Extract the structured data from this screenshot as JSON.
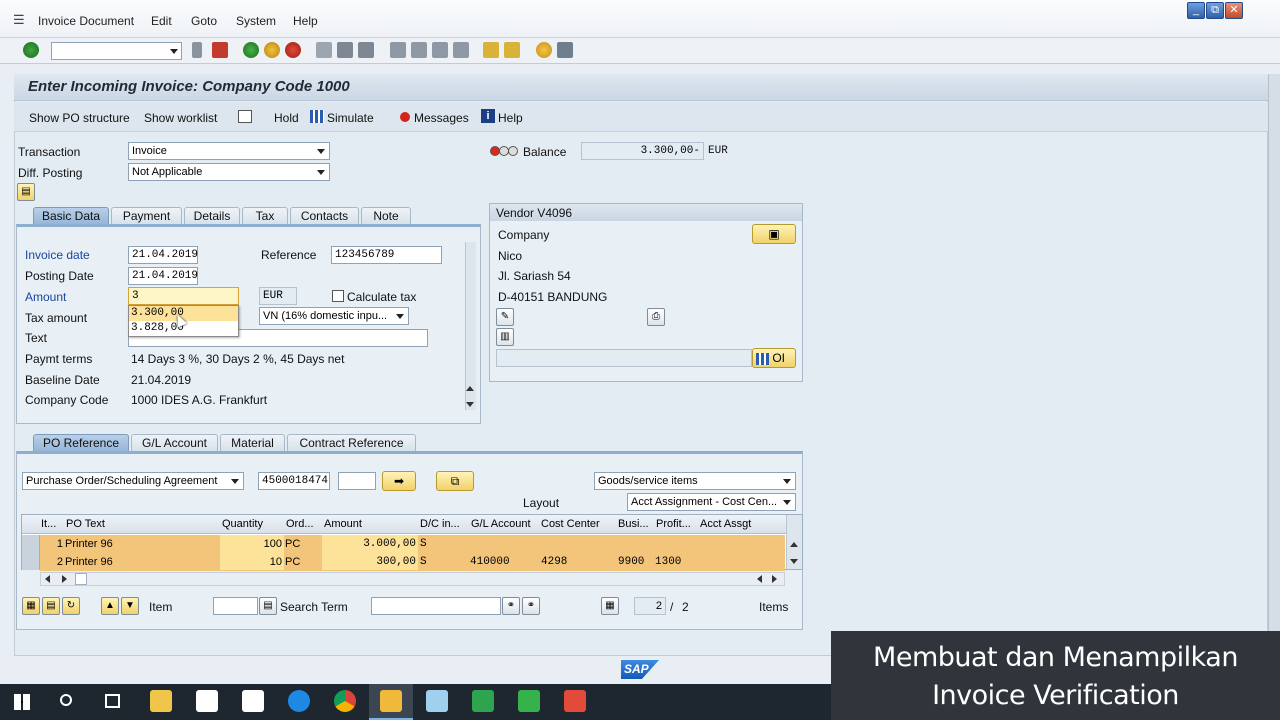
{
  "menu": {
    "items": [
      "Invoice Document",
      "Edit",
      "Goto",
      "System",
      "Help"
    ]
  },
  "window_controls": {
    "minimize": "_",
    "restore": "⧉",
    "close": "✕"
  },
  "title": "Enter Incoming Invoice: Company Code 1000",
  "app_toolbar": {
    "show_po_structure": "Show PO structure",
    "show_worklist": "Show worklist",
    "hold": "Hold",
    "simulate": "Simulate",
    "messages": "Messages",
    "help": "Help"
  },
  "header": {
    "transaction_label": "Transaction",
    "transaction_value": "Invoice",
    "diff_posting_label": "Diff. Posting",
    "diff_posting_value": "Not Applicable",
    "balance_label": "Balance",
    "balance_value": "3.300,00-",
    "balance_currency": "EUR"
  },
  "top_tabs": [
    "Basic Data",
    "Payment",
    "Details",
    "Tax",
    "Contacts",
    "Note"
  ],
  "basic_data": {
    "invoice_date_label": "Invoice date",
    "invoice_date_value": "21.04.2019",
    "reference_label": "Reference",
    "reference_value": "123456789",
    "posting_date_label": "Posting Date",
    "posting_date_value": "21.04.2019",
    "amount_label": "Amount",
    "amount_value": "3",
    "currency_value": "EUR",
    "calculate_tax_label": "Calculate tax",
    "tax_amount_label": "Tax amount",
    "tax_code_value": "VN (16% domestic inpu...",
    "text_label": "Text",
    "paymt_terms_label": "Paymt terms",
    "paymt_terms_value": "14 Days 3 %, 30 Days 2 %, 45 Days net",
    "baseline_date_label": "Baseline Date",
    "baseline_date_value": "21.04.2019",
    "company_code_label": "Company Code",
    "company_code_value": "1000 IDES A.G. Frankfurt",
    "autocomplete": [
      "3.300,00",
      "3.828,00"
    ]
  },
  "vendor": {
    "title": "Vendor V4096",
    "line1": "Company",
    "line2": "Nico",
    "line3": "Jl. Sariash 54",
    "line4": "D-40151 BANDUNG",
    "oi_label": "OI"
  },
  "bottom_tabs": [
    "PO Reference",
    "G/L Account",
    "Material",
    "Contract Reference"
  ],
  "po_reference": {
    "doc_type": "Purchase Order/Scheduling Agreement",
    "po_number": "4500018474",
    "items_type": "Goods/service items",
    "layout_label": "Layout",
    "layout_value": "Acct Assignment - Cost Cen...",
    "columns": [
      "It...",
      "PO Text",
      "Quantity",
      "Ord...",
      "Amount",
      "D/C in...",
      "G/L Account",
      "Cost Center",
      "Busi...",
      "Profit...",
      "Acct Assgt"
    ],
    "rows": [
      [
        "1",
        "Printer 96",
        "100",
        "PC",
        "3.000,00",
        "S",
        "",
        "",
        "",
        "",
        ""
      ],
      [
        "2",
        "Printer 96",
        "10",
        "PC",
        "300,00",
        "S",
        "410000",
        "4298",
        "9900",
        "1300",
        ""
      ]
    ],
    "item_label": "Item",
    "search_term_label": "Search Term",
    "page_current": "2",
    "page_sep": "/",
    "page_total": "2",
    "items_label": "Items"
  },
  "sap_logo": "SAP",
  "overlay_caption": "Membuat dan Menampilkan Invoice Verification",
  "colors": {
    "accent": "#1a46a0",
    "row_highlight": "#f2c57a",
    "overlay": "#2f353b"
  }
}
